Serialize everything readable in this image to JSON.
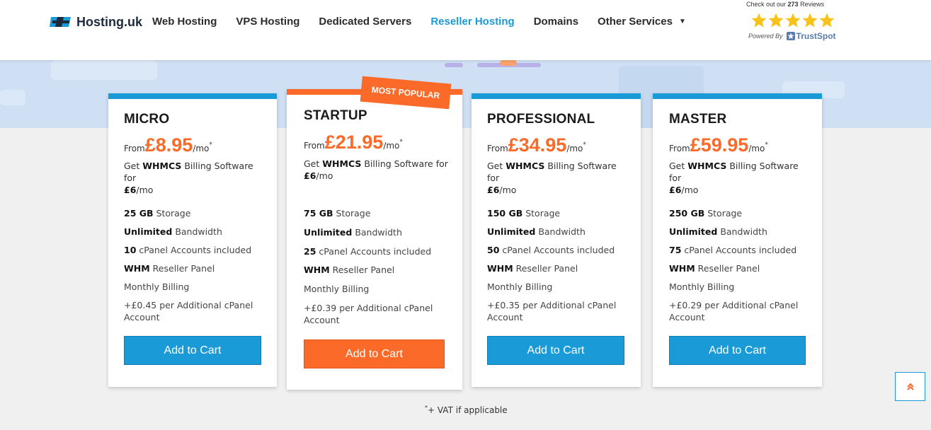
{
  "header": {
    "logo_text": "Hosting.uk",
    "nav": [
      {
        "label": "Web Hosting"
      },
      {
        "label": "VPS Hosting"
      },
      {
        "label": "Dedicated Servers"
      },
      {
        "label": "Reseller Hosting",
        "active": true
      },
      {
        "label": "Domains"
      },
      {
        "label": "Other Services"
      }
    ],
    "trust": {
      "prefix": "Check out our ",
      "count": "273",
      "suffix": " Reviews",
      "rating_stars": 5,
      "powered_by": "Powered By",
      "brand": "TrustSpot"
    }
  },
  "colors": {
    "accent_blue": "#1a9ad6",
    "accent_orange": "#fb6a28"
  },
  "plans": [
    {
      "name": "MICRO",
      "from": "From",
      "price": "£8.95",
      "per": "/mo",
      "asterisk": "*",
      "whmcs_pre": "Get ",
      "whmcs_bold": "WHMCS",
      "whmcs_mid": " Billing Software for",
      "whmcs_price": "£6",
      "whmcs_per": "/mo",
      "features": [
        {
          "bold": "25 GB",
          "text": " Storage"
        },
        {
          "bold": "Unlimited",
          "text": " Bandwidth"
        },
        {
          "bold": "10",
          "text": " cPanel Accounts included"
        },
        {
          "bold": "WHM",
          "text": " Reseller Panel"
        },
        {
          "bold": "",
          "text": "Monthly Billing"
        }
      ],
      "extra_line1": "+£0.45 per Additional cPanel",
      "extra_line2": "Account",
      "button": "Add to Cart"
    },
    {
      "name": "STARTUP",
      "badge": "MOST POPULAR",
      "from": "From",
      "price": "£21.95",
      "per": "/mo",
      "asterisk": "*",
      "whmcs_pre": "Get ",
      "whmcs_bold": "WHMCS",
      "whmcs_mid": " Billing Software for",
      "whmcs_price": "£6",
      "whmcs_per": "/mo",
      "features": [
        {
          "bold": "75 GB",
          "text": " Storage"
        },
        {
          "bold": "Unlimited",
          "text": " Bandwidth"
        },
        {
          "bold": "25",
          "text": " cPanel Accounts included"
        },
        {
          "bold": "WHM",
          "text": " Reseller Panel"
        },
        {
          "bold": "",
          "text": "Monthly Billing"
        }
      ],
      "extra_line1": "+£0.39 per Additional cPanel",
      "extra_line2": "Account",
      "button": "Add to Cart"
    },
    {
      "name": "PROFESSIONAL",
      "from": "From",
      "price": "£34.95",
      "per": "/mo",
      "asterisk": "*",
      "whmcs_pre": "Get ",
      "whmcs_bold": "WHMCS",
      "whmcs_mid": " Billing Software for",
      "whmcs_price": "£6",
      "whmcs_per": "/mo",
      "features": [
        {
          "bold": "150 GB",
          "text": " Storage"
        },
        {
          "bold": "Unlimited",
          "text": " Bandwidth"
        },
        {
          "bold": "50",
          "text": " cPanel Accounts included"
        },
        {
          "bold": "WHM",
          "text": " Reseller Panel"
        },
        {
          "bold": "",
          "text": "Monthly Billing"
        }
      ],
      "extra_line1": "+£0.35 per Additional cPanel",
      "extra_line2": "Account",
      "button": "Add to Cart"
    },
    {
      "name": "MASTER",
      "from": "From",
      "price": "£59.95",
      "per": "/mo",
      "asterisk": "*",
      "whmcs_pre": "Get ",
      "whmcs_bold": "WHMCS",
      "whmcs_mid": " Billing Software for",
      "whmcs_price": "£6",
      "whmcs_per": "/mo",
      "features": [
        {
          "bold": "250 GB",
          "text": " Storage"
        },
        {
          "bold": "Unlimited",
          "text": " Bandwidth"
        },
        {
          "bold": "75",
          "text": " cPanel Accounts included"
        },
        {
          "bold": "WHM",
          "text": " Reseller Panel"
        },
        {
          "bold": "",
          "text": "Monthly Billing"
        }
      ],
      "extra_line1": "+£0.29 per Additional cPanel",
      "extra_line2": "Account",
      "button": "Add to Cart"
    }
  ],
  "footnote": {
    "asterisk": "*",
    "text": "+ VAT if applicable"
  },
  "scroll_top_icon": "double-chevron-up-icon"
}
